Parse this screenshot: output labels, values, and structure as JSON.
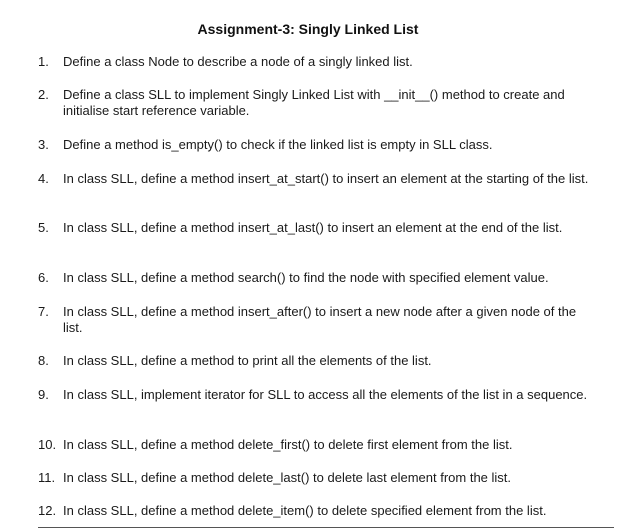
{
  "title": "Assignment-3: Singly Linked List",
  "items": [
    {
      "num": "1.",
      "text": "Define a class Node to describe a node of a singly linked list."
    },
    {
      "num": "2.",
      "text": "Define a class SLL to implement Singly Linked List with __init__() method to create and initialise start reference variable."
    },
    {
      "num": "3.",
      "text": "Define a method is_empty() to check if the linked list is empty in SLL class."
    },
    {
      "num": "4.",
      "text": "In class SLL, define a method insert_at_start() to insert an element at the starting of the list."
    },
    {
      "num": "5.",
      "text": "In class SLL, define a method insert_at_last() to insert an element at the end of the list."
    },
    {
      "num": "6.",
      "text": "In class SLL, define a method search() to find the node with specified element value."
    },
    {
      "num": "7.",
      "text": "In class SLL, define a method insert_after() to insert a new node after a given node of the list."
    },
    {
      "num": "8.",
      "text": "In class SLL, define a method to print all the elements of the list."
    },
    {
      "num": "9.",
      "text": "In class SLL, implement iterator for SLL to access all the elements of the list in a sequence."
    },
    {
      "num": "10.",
      "text": "In class SLL, define a method delete_first() to delete first element from the list."
    },
    {
      "num": "11.",
      "text": "In class SLL, define a method delete_last() to delete last element from the list."
    },
    {
      "num": "12.",
      "text": "In class SLL, define a method delete_item() to delete specified element from the list."
    }
  ]
}
